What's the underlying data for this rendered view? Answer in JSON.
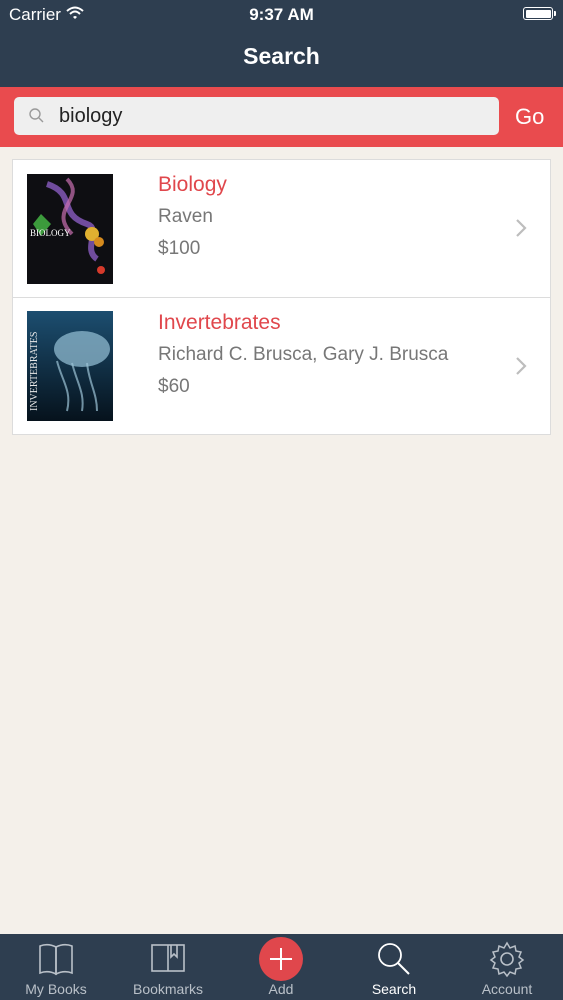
{
  "status_bar": {
    "carrier": "Carrier",
    "time": "9:37 AM"
  },
  "header": {
    "title": "Search"
  },
  "search": {
    "query": "biology",
    "go_label": "Go"
  },
  "results": [
    {
      "title": "Biology",
      "author": "Raven",
      "price": "$100"
    },
    {
      "title": "Invertebrates",
      "author": "Richard C. Brusca, Gary J. Brusca",
      "price": "$60"
    }
  ],
  "tabs": [
    {
      "label": "My Books",
      "icon": "book-open-icon"
    },
    {
      "label": "Bookmarks",
      "icon": "bookmark-icon"
    },
    {
      "label": "Add",
      "icon": "plus-icon"
    },
    {
      "label": "Search",
      "icon": "search-icon",
      "active": true
    },
    {
      "label": "Account",
      "icon": "gear-icon"
    }
  ],
  "colors": {
    "navy": "#2e3e50",
    "accent": "#e94b4e",
    "title_red": "#e0474c",
    "background": "#f4f0ea"
  }
}
